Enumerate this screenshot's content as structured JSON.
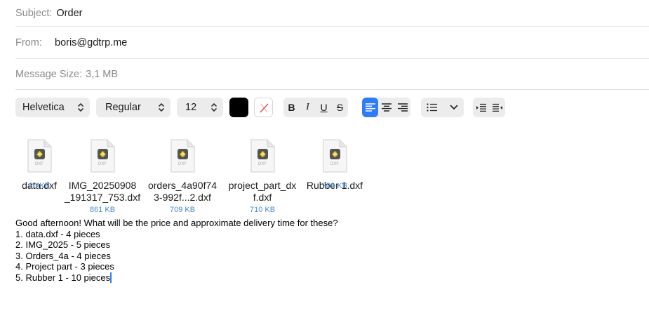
{
  "header": {
    "subject_label": "Subject:",
    "subject_value": "Order",
    "from_label": "From:",
    "from_value": "boris@gdtrp.me",
    "size_label": "Message Size:",
    "size_value": "3,1 MB"
  },
  "toolbar": {
    "font_family": "Helvetica",
    "font_style": "Regular",
    "font_size": "12",
    "text_color": "#000000",
    "bold_label": "B",
    "italic_label": "I",
    "underline_label": "U",
    "strike_label": "S",
    "active_alignment": "left"
  },
  "attachments": [
    {
      "name_line1": "data.dxf",
      "name_line2": "",
      "size": "26 KB"
    },
    {
      "name_line1": "IMG_20250908",
      "name_line2": "_191317_753.dxf",
      "size": "861 KB"
    },
    {
      "name_line1": "orders_4a90f74",
      "name_line2": "3-992f...2.dxf",
      "size": "709 KB"
    },
    {
      "name_line1": "project_part_dx",
      "name_line2": "f.dxf",
      "size": "710 KB"
    },
    {
      "name_line1": "Rubber 1.dxf",
      "name_line2": "",
      "size": "709 KB"
    }
  ],
  "file_icon_label": "DXF",
  "body": {
    "lines": [
      "Good afternoon! What will be the price and approximate delivery time for these?",
      "1. data.dxf - 4 pieces",
      "2. IMG_2025 - 5 pieces",
      "3. Orders_4a - 4 pieces",
      "4. Project part - 3 pieces",
      "5. Rubber 1 - 10 pieces"
    ]
  }
}
